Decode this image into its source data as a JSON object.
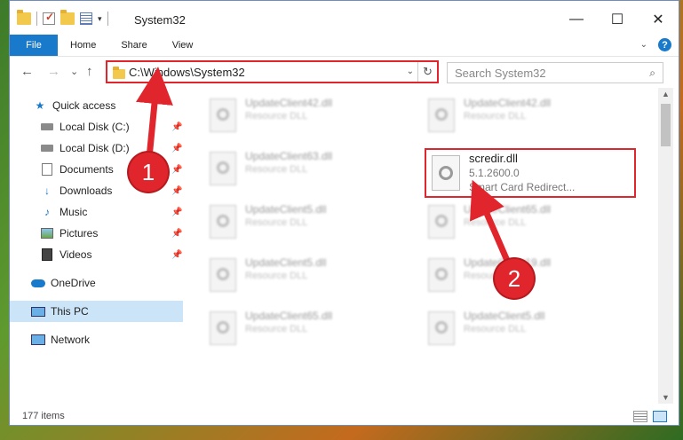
{
  "window": {
    "title": "System32",
    "controls": {
      "minimize": "—",
      "maximize": "☐",
      "close": "✕"
    }
  },
  "ribbon": {
    "file_tab": "File",
    "tabs": [
      "Home",
      "Share",
      "View"
    ],
    "help": "?"
  },
  "nav": {
    "back_icon": "←",
    "forward_icon": "→",
    "recent_icon": "⌄",
    "up_icon": "↑",
    "address": "C:\\Windows\\System32",
    "refresh_icon": "↻",
    "search_placeholder": "Search System32",
    "search_icon": "⌕"
  },
  "sidebar": {
    "items": [
      {
        "label": "Quick access",
        "icon": "star-icon",
        "pinned": false
      },
      {
        "label": "Local Disk (C:)",
        "icon": "disk-icon",
        "pinned": true
      },
      {
        "label": "Local Disk (D:)",
        "icon": "disk-icon",
        "pinned": true
      },
      {
        "label": "Documents",
        "icon": "documents-icon",
        "pinned": true
      },
      {
        "label": "Downloads",
        "icon": "downloads-icon",
        "pinned": true
      },
      {
        "label": "Music",
        "icon": "music-icon",
        "pinned": true
      },
      {
        "label": "Pictures",
        "icon": "pictures-icon",
        "pinned": true
      },
      {
        "label": "Videos",
        "icon": "videos-icon",
        "pinned": true
      },
      {
        "label": "OneDrive",
        "icon": "onedrive-icon",
        "pinned": false
      },
      {
        "label": "This PC",
        "icon": "this-pc-icon",
        "pinned": false,
        "selected": true
      },
      {
        "label": "Network",
        "icon": "network-icon",
        "pinned": false
      }
    ]
  },
  "files": [
    {
      "name": "UpdateClient42.dll",
      "desc": "Resource DLL"
    },
    {
      "name": "UpdateClient42.dll",
      "desc": "Resource DLL"
    },
    {
      "name": "UpdateClient63.dll",
      "desc": "Resource DLL"
    },
    {
      "name": "UpdateClient5.dll",
      "desc": "Resource DLL"
    },
    {
      "name": "UpdateClient65.dll",
      "desc": "Resource DLL"
    },
    {
      "name": "UpdateClient5.dll",
      "desc": "Resource DLL"
    },
    {
      "name": "UpdateClient19.dll",
      "desc": "Resource DLL"
    },
    {
      "name": "UpdateClient65.dll",
      "desc": "Resource DLL"
    },
    {
      "name": "UpdateClient5.dll",
      "desc": "Resource DLL"
    }
  ],
  "highlighted_file": {
    "name": "scredir.dll",
    "version": "5.1.2600.0",
    "description": "Smart Card Redirect..."
  },
  "status": {
    "item_count": "177 items"
  },
  "annotations": {
    "step1": "1",
    "step2": "2",
    "color": "#e0262c"
  }
}
